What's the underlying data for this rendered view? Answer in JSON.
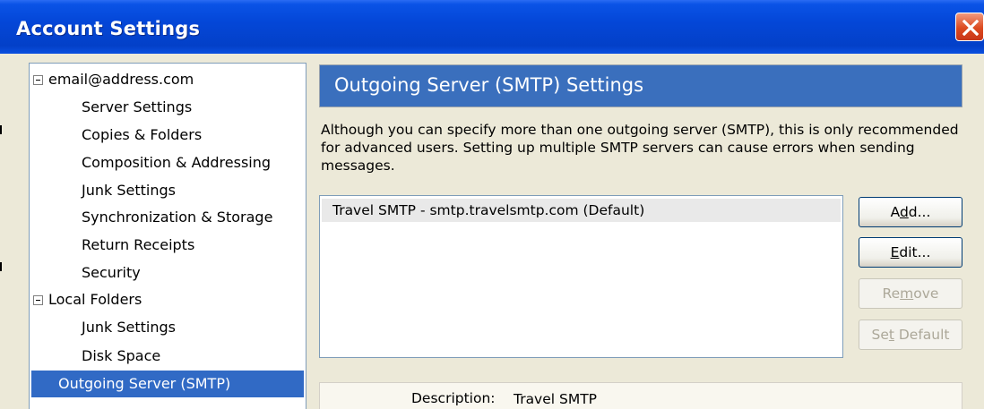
{
  "window": {
    "title": "Account Settings",
    "close_icon": "close-icon",
    "accent_color": "#0447d8",
    "close_color": "#dc4a1f"
  },
  "tree": {
    "selection_color": "#316ac5",
    "items": [
      {
        "label": "email@address.com",
        "level": 0,
        "expanded": true,
        "selected": false
      },
      {
        "label": "Server Settings",
        "level": 1,
        "selected": false
      },
      {
        "label": "Copies & Folders",
        "level": 1,
        "selected": false
      },
      {
        "label": "Composition & Addressing",
        "level": 1,
        "selected": false
      },
      {
        "label": "Junk Settings",
        "level": 1,
        "selected": false
      },
      {
        "label": "Synchronization & Storage",
        "level": 1,
        "selected": false
      },
      {
        "label": "Return Receipts",
        "level": 1,
        "selected": false
      },
      {
        "label": "Security",
        "level": 1,
        "selected": false
      },
      {
        "label": "Local Folders",
        "level": 0,
        "expanded": true,
        "selected": false
      },
      {
        "label": "Junk Settings",
        "level": 1,
        "selected": false
      },
      {
        "label": "Disk Space",
        "level": 1,
        "selected": false
      },
      {
        "label": "Outgoing Server (SMTP)",
        "level": 0,
        "selected": true
      }
    ]
  },
  "main": {
    "header": "Outgoing Server (SMTP) Settings",
    "header_color": "#3a6fbd",
    "intro": "Although you can specify more than one outgoing server (SMTP), this is only recommended for advanced users. Setting up multiple SMTP servers can cause errors when sending messages.",
    "servers": [
      "Travel SMTP - smtp.travelsmtp.com (Default)"
    ],
    "buttons": {
      "add": {
        "pre": "A",
        "key": "d",
        "post": "d..."
      },
      "edit": {
        "pre": "",
        "key": "E",
        "post": "dit..."
      },
      "remove": {
        "pre": "Re",
        "key": "m",
        "post": "ove"
      },
      "set_default": {
        "pre": "Se",
        "key": "t",
        "post": " Default"
      }
    },
    "details": {
      "description_label": "Description:",
      "description_value": "Travel SMTP"
    }
  }
}
